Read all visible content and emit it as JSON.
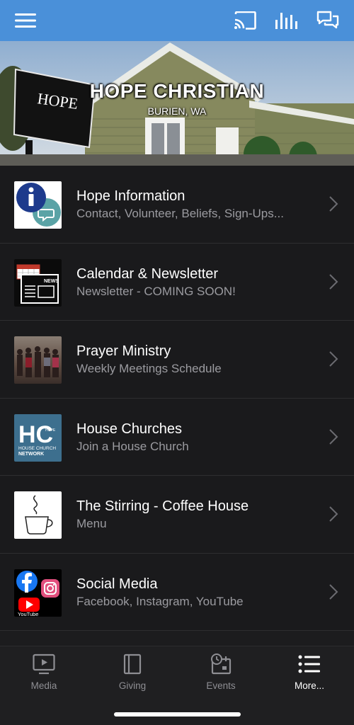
{
  "header": {
    "menu_icon": "hamburger-icon",
    "cast_icon": "cast-icon",
    "audio_icon": "equalizer-icon",
    "chat_icon": "chat-bubbles-icon",
    "bar_color": "#4a90d9"
  },
  "hero": {
    "title": "HOPE CHRISTIAN",
    "subtitle": "BURIEN, WA"
  },
  "items": [
    {
      "title": "Hope Information",
      "subtitle": "Contact, Volunteer, Beliefs, Sign-Ups...",
      "icon": "info-chat-icon"
    },
    {
      "title": "Calendar & Newsletter",
      "subtitle": "Newsletter - COMING SOON!",
      "icon": "calendar-newspaper-icon",
      "badge": "NEWS"
    },
    {
      "title": "Prayer Ministry",
      "subtitle": "Weekly Meetings Schedule",
      "icon": "group-photo"
    },
    {
      "title": "House Churches",
      "subtitle": "Join a House Church",
      "icon": "house-church-logo",
      "logo_letters": "HC",
      "logo_small": "HOPE",
      "logo_text_1": "HOUSE CHURCH",
      "logo_text_2": "NETWORK"
    },
    {
      "title": "The Stirring - Coffee House",
      "subtitle": "Menu",
      "icon": "coffee-cup-icon"
    },
    {
      "title": "Social Media",
      "subtitle": "Facebook, Instagram, YouTube",
      "icon": "social-logos-icon",
      "yt_label": "YouTube"
    }
  ],
  "tabs": [
    {
      "label": "Media",
      "icon": "tv-play-icon",
      "active": false
    },
    {
      "label": "Giving",
      "icon": "book-icon",
      "active": false
    },
    {
      "label": "Events",
      "icon": "calendar-clock-icon",
      "active": false
    },
    {
      "label": "More...",
      "icon": "list-icon",
      "active": true
    }
  ]
}
